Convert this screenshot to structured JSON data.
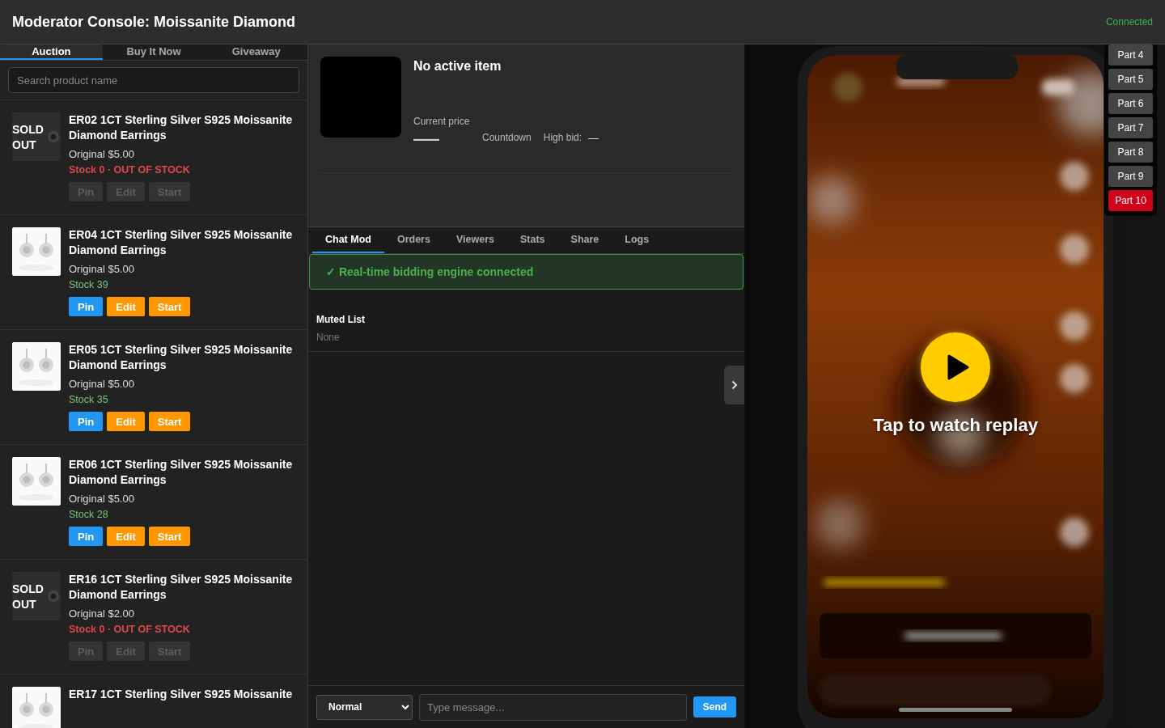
{
  "header": {
    "title": "Moderator Console: Moissanite Diamond",
    "status": "Connected"
  },
  "product_tabs": [
    {
      "label": "Auction",
      "selected": true
    },
    {
      "label": "Buy It Now",
      "selected": false
    },
    {
      "label": "Giveaway",
      "selected": false
    }
  ],
  "search": {
    "placeholder": "Search product name"
  },
  "products": [
    {
      "title": "ER02 1CT Sterling Silver S925 Moissanite Diamond Earrings",
      "sold_out": true,
      "badge": "SOLD OUT",
      "original": "Original $5.00",
      "stock": "Stock 0 · OUT OF STOCK",
      "in_stock": false,
      "buttons": [
        {
          "label": "Pin",
          "kind": "pin",
          "disabled": true
        },
        {
          "label": "Edit",
          "kind": "edit",
          "disabled": true
        },
        {
          "label": "Start",
          "kind": "start",
          "disabled": true
        }
      ]
    },
    {
      "title": "ER04 1CT Sterling Silver S925 Moissanite Diamond Earrings",
      "sold_out": false,
      "original": "Original $5.00",
      "stock": "Stock 39",
      "in_stock": true,
      "buttons": [
        {
          "label": "Pin",
          "kind": "pin",
          "disabled": false
        },
        {
          "label": "Edit",
          "kind": "edit",
          "disabled": false
        },
        {
          "label": "Start",
          "kind": "start",
          "disabled": false
        }
      ]
    },
    {
      "title": "ER05 1CT Sterling Silver S925 Moissanite Diamond Earrings",
      "sold_out": false,
      "original": "Original $5.00",
      "stock": "Stock 35",
      "in_stock": true,
      "buttons": [
        {
          "label": "Pin",
          "kind": "pin",
          "disabled": false
        },
        {
          "label": "Edit",
          "kind": "edit",
          "disabled": false
        },
        {
          "label": "Start",
          "kind": "start",
          "disabled": false
        }
      ]
    },
    {
      "title": "ER06 1CT Sterling Silver S925 Moissanite Diamond Earrings",
      "sold_out": false,
      "original": "Original $5.00",
      "stock": "Stock 28",
      "in_stock": true,
      "buttons": [
        {
          "label": "Pin",
          "kind": "pin",
          "disabled": false
        },
        {
          "label": "Edit",
          "kind": "edit",
          "disabled": false
        },
        {
          "label": "Start",
          "kind": "start",
          "disabled": false
        }
      ]
    },
    {
      "title": "ER16 1CT Sterling Silver S925 Moissanite Diamond Earrings",
      "sold_out": true,
      "badge": "SOLD OUT",
      "original": "Original $2.00",
      "stock": "Stock 0 · OUT OF STOCK",
      "in_stock": false,
      "buttons": [
        {
          "label": "Pin",
          "kind": "pin",
          "disabled": true
        },
        {
          "label": "Edit",
          "kind": "edit",
          "disabled": true
        },
        {
          "label": "Start",
          "kind": "start",
          "disabled": true
        }
      ]
    },
    {
      "title": "ER17 1CT Sterling Silver S925 Moissanite",
      "sold_out": false
    }
  ],
  "active_item": {
    "title": "No active item",
    "price_label": "Current price",
    "price": "—",
    "countdown_label": "Countdown",
    "high_bid_label": "High bid:",
    "high_bid": "—"
  },
  "panel_tabs": [
    {
      "label": "Chat Mod",
      "selected": true
    },
    {
      "label": "Orders",
      "selected": false
    },
    {
      "label": "Viewers",
      "selected": false
    },
    {
      "label": "Stats",
      "selected": false
    },
    {
      "label": "Share",
      "selected": false
    },
    {
      "label": "Logs",
      "selected": false
    }
  ],
  "engine_banner": "✓ Real-time bidding engine connected",
  "muted_list": {
    "title": "Muted List",
    "value": "None"
  },
  "composer": {
    "mode": "Normal",
    "placeholder": "Type message...",
    "send": "Send"
  },
  "preview": {
    "caption": "Tap to watch replay",
    "parts": [
      {
        "label": "Part 4",
        "selected": false
      },
      {
        "label": "Part 5",
        "selected": false
      },
      {
        "label": "Part 6",
        "selected": false
      },
      {
        "label": "Part 7",
        "selected": false
      },
      {
        "label": "Part 8",
        "selected": false
      },
      {
        "label": "Part 9",
        "selected": false
      },
      {
        "label": "Part 10",
        "selected": true
      }
    ]
  }
}
